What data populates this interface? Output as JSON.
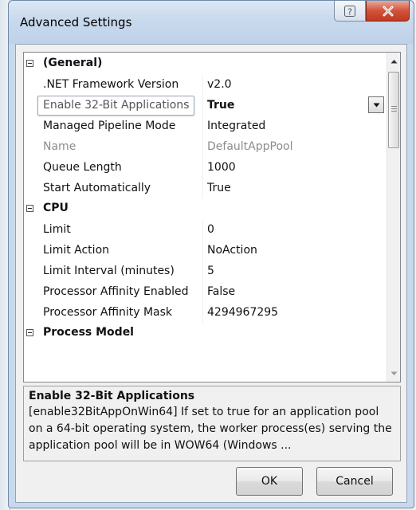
{
  "window": {
    "title": "Advanced Settings",
    "help_label": "?"
  },
  "grid": {
    "rows": [
      {
        "kind": "category",
        "label": "(General)"
      },
      {
        "kind": "property",
        "name": ".NET Framework Version",
        "value": "v2.0"
      },
      {
        "kind": "property",
        "name": "Enable 32-Bit Applications",
        "value": "True",
        "selected": true
      },
      {
        "kind": "property",
        "name": "Managed Pipeline Mode",
        "value": "Integrated"
      },
      {
        "kind": "property",
        "name": "Name",
        "value": "DefaultAppPool",
        "disabled": true
      },
      {
        "kind": "property",
        "name": "Queue Length",
        "value": "1000"
      },
      {
        "kind": "property",
        "name": "Start Automatically",
        "value": "True"
      },
      {
        "kind": "category",
        "label": "CPU"
      },
      {
        "kind": "property",
        "name": "Limit",
        "value": "0"
      },
      {
        "kind": "property",
        "name": "Limit Action",
        "value": "NoAction"
      },
      {
        "kind": "property",
        "name": "Limit Interval (minutes)",
        "value": "5"
      },
      {
        "kind": "property",
        "name": "Processor Affinity Enabled",
        "value": "False"
      },
      {
        "kind": "property",
        "name": "Processor Affinity Mask",
        "value": "4294967295"
      },
      {
        "kind": "category",
        "label": "Process Model"
      }
    ]
  },
  "description": {
    "title": "Enable 32-Bit Applications",
    "text": "[enable32BitAppOnWin64] If set to true for an application pool on a 64-bit operating system, the worker process(es) serving the application pool will be in WOW64 (Windows ..."
  },
  "buttons": {
    "ok": "OK",
    "cancel": "Cancel"
  },
  "icons": {
    "help": "help-icon",
    "close": "close-icon",
    "dropdown": "chevron-down-icon",
    "scroll_up": "scroll-up-icon",
    "scroll_down": "scroll-down-icon"
  },
  "colors": {
    "title_bar": "#c8d9ed",
    "close_button": "#d1523a",
    "grid_background": "#ffffff",
    "disabled_text": "#8c8c8c"
  }
}
